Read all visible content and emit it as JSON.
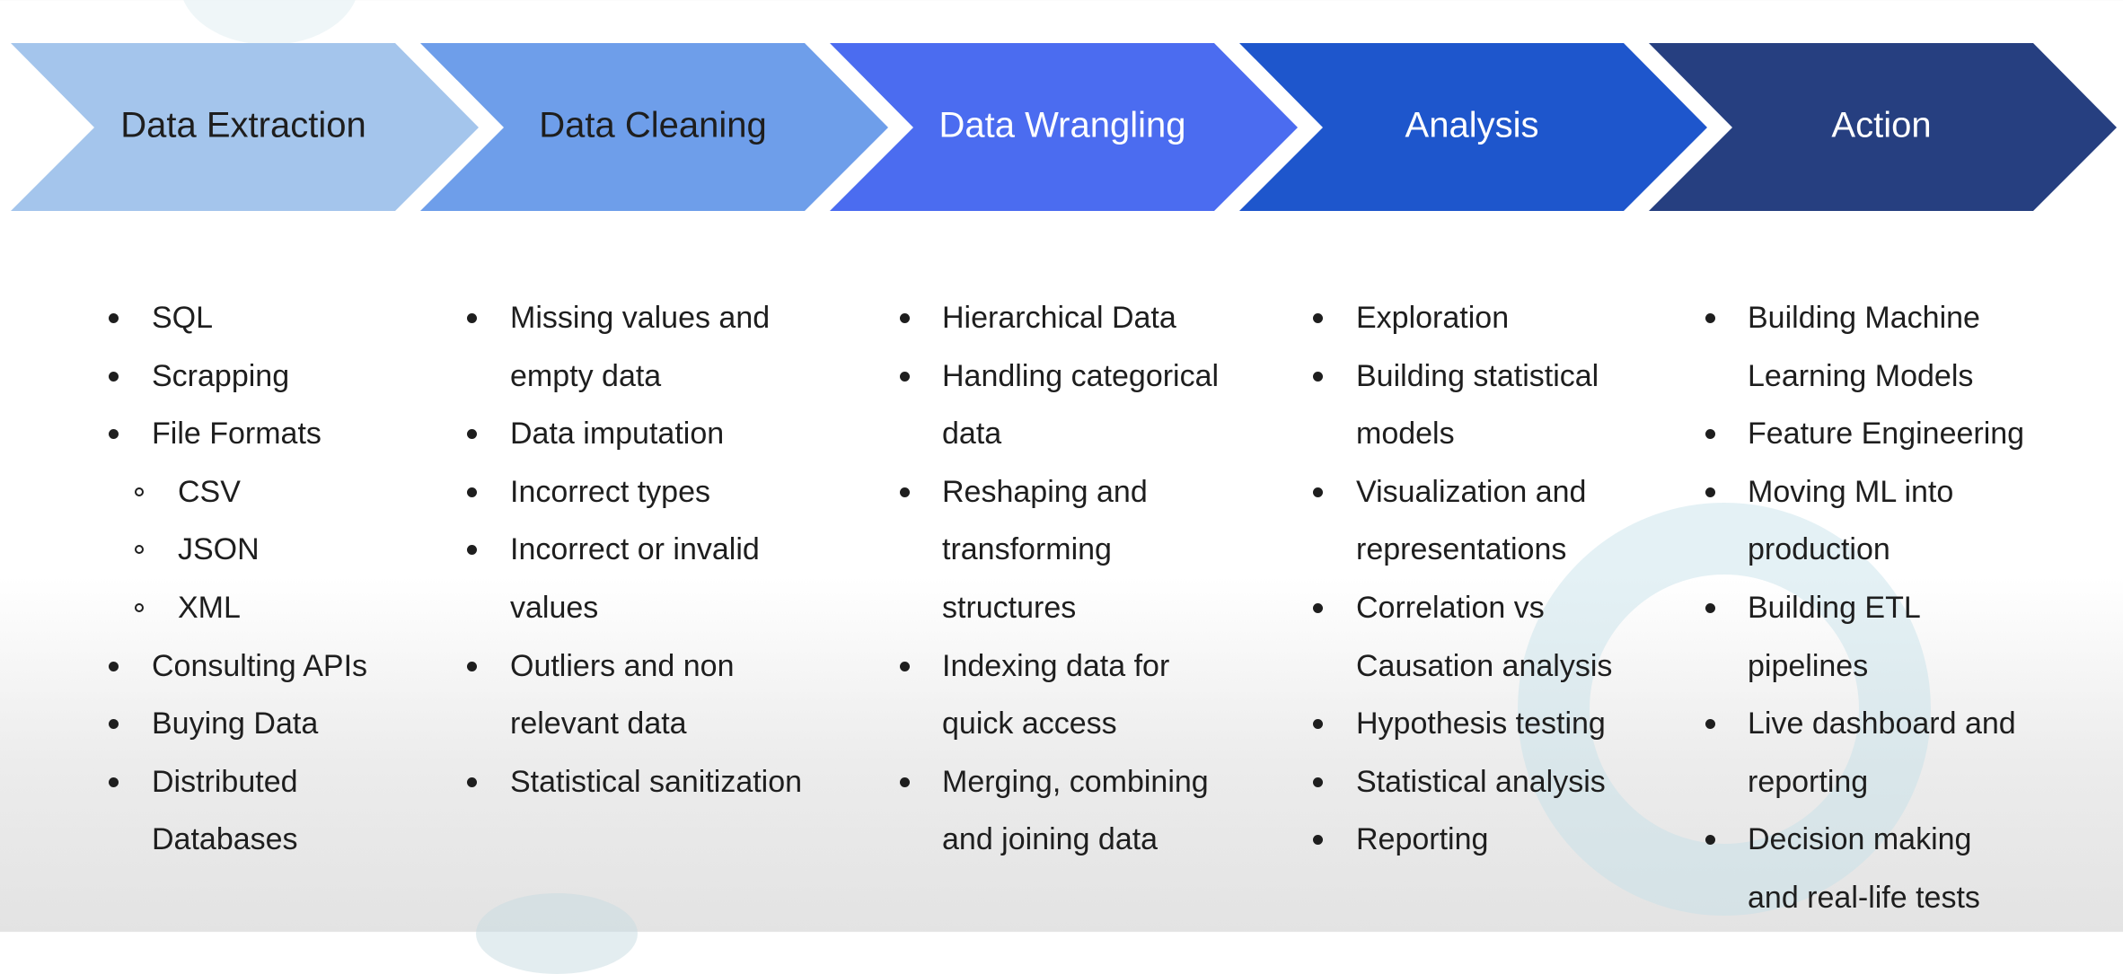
{
  "stages": [
    {
      "label": "Data Extraction",
      "color": "#a4c5ec",
      "text_color": "#1e1e1e"
    },
    {
      "label": "Data Cleaning",
      "color": "#6e9eea",
      "text_color": "#1e1e1e"
    },
    {
      "label": "Data Wrangling",
      "color": "#4b6cf0",
      "text_color": "#ffffff"
    },
    {
      "label": "Analysis",
      "color": "#1e56cc",
      "text_color": "#ffffff"
    },
    {
      "label": "Action",
      "color": "#263f80",
      "text_color": "#ffffff"
    }
  ],
  "columns": [
    [
      {
        "text": "SQL",
        "level": 1,
        "continues": false
      },
      {
        "text": "Scrapping",
        "level": 1,
        "continues": false
      },
      {
        "text": "File Formats",
        "level": 1,
        "continues": false
      },
      {
        "text": "CSV",
        "level": 2,
        "continues": false
      },
      {
        "text": "JSON",
        "level": 2,
        "continues": false
      },
      {
        "text": "XML",
        "level": 2,
        "continues": false
      },
      {
        "text": "Consulting APIs",
        "level": 1,
        "continues": false
      },
      {
        "text": "Buying Data",
        "level": 1,
        "continues": false
      },
      {
        "text": "Distributed",
        "level": 1,
        "continues": false
      },
      {
        "text": "Databases",
        "level": 1,
        "continues": true
      }
    ],
    [
      {
        "text": "Missing values and",
        "level": 1,
        "continues": false
      },
      {
        "text": "empty data",
        "level": 1,
        "continues": true
      },
      {
        "text": "Data imputation",
        "level": 1,
        "continues": false
      },
      {
        "text": "Incorrect types",
        "level": 1,
        "continues": false
      },
      {
        "text": "Incorrect or invalid",
        "level": 1,
        "continues": false
      },
      {
        "text": "values",
        "level": 1,
        "continues": true
      },
      {
        "text": "Outliers and non",
        "level": 1,
        "continues": false
      },
      {
        "text": "relevant data",
        "level": 1,
        "continues": true
      },
      {
        "text": "Statistical sanitization",
        "level": 1,
        "continues": false
      }
    ],
    [
      {
        "text": "Hierarchical Data",
        "level": 1,
        "continues": false
      },
      {
        "text": "Handling categorical",
        "level": 1,
        "continues": false
      },
      {
        "text": "data",
        "level": 1,
        "continues": true
      },
      {
        "text": "Reshaping and",
        "level": 1,
        "continues": false
      },
      {
        "text": "transforming",
        "level": 1,
        "continues": true
      },
      {
        "text": "structures",
        "level": 1,
        "continues": true
      },
      {
        "text": "Indexing data for",
        "level": 1,
        "continues": false
      },
      {
        "text": "quick access",
        "level": 1,
        "continues": true
      },
      {
        "text": "Merging, combining",
        "level": 1,
        "continues": false
      },
      {
        "text": "and joining data",
        "level": 1,
        "continues": true
      }
    ],
    [
      {
        "text": "Exploration",
        "level": 1,
        "continues": false
      },
      {
        "text": "Building statistical",
        "level": 1,
        "continues": false
      },
      {
        "text": "models",
        "level": 1,
        "continues": true
      },
      {
        "text": "Visualization and",
        "level": 1,
        "continues": false
      },
      {
        "text": "representations",
        "level": 1,
        "continues": true
      },
      {
        "text": "Correlation vs",
        "level": 1,
        "continues": false
      },
      {
        "text": "Causation analysis",
        "level": 1,
        "continues": true
      },
      {
        "text": "Hypothesis testing",
        "level": 1,
        "continues": false
      },
      {
        "text": "Statistical analysis",
        "level": 1,
        "continues": false
      },
      {
        "text": "Reporting",
        "level": 1,
        "continues": false
      }
    ],
    [
      {
        "text": "Building Machine",
        "level": 1,
        "continues": false
      },
      {
        "text": "Learning Models",
        "level": 1,
        "continues": true
      },
      {
        "text": "Feature Engineering",
        "level": 1,
        "continues": false
      },
      {
        "text": "Moving ML into",
        "level": 1,
        "continues": false
      },
      {
        "text": "production",
        "level": 1,
        "continues": true
      },
      {
        "text": "Building ETL",
        "level": 1,
        "continues": false
      },
      {
        "text": "pipelines",
        "level": 1,
        "continues": true
      },
      {
        "text": "Live dashboard and",
        "level": 1,
        "continues": false
      },
      {
        "text": "reporting",
        "level": 1,
        "continues": true
      },
      {
        "text": "Decision making",
        "level": 1,
        "continues": false
      },
      {
        "text": "and real-life tests",
        "level": 1,
        "continues": true
      }
    ]
  ]
}
